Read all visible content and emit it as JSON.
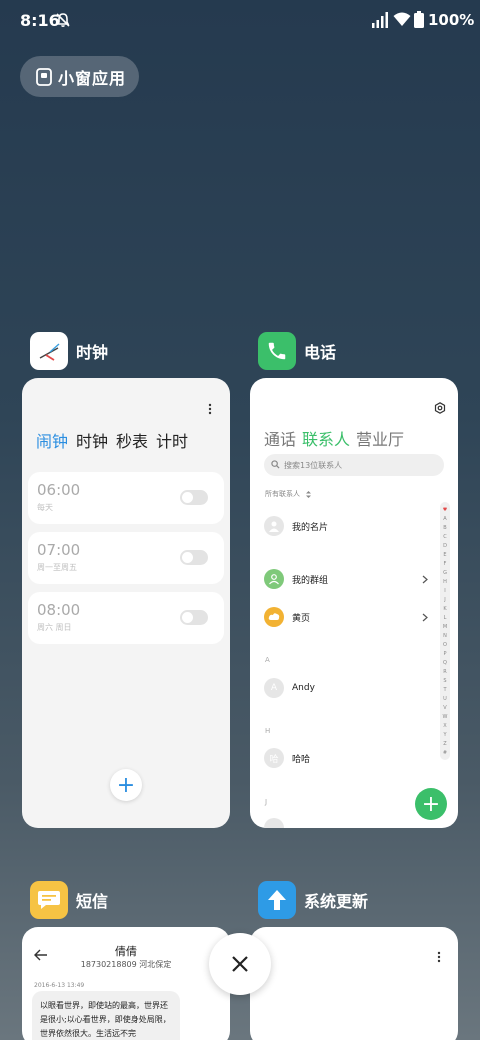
{
  "status_bar": {
    "time": "8:16",
    "battery": "100%"
  },
  "pill": {
    "label": "小窗应用"
  },
  "apps": {
    "clock": {
      "name": "时钟",
      "tabs": [
        "闹钟",
        "时钟",
        "秒表",
        "计时"
      ],
      "alarms": [
        {
          "time": "06:00",
          "repeat": "每天"
        },
        {
          "time": "07:00",
          "repeat": "周一至周五"
        },
        {
          "time": "08:00",
          "repeat": "周六 周日"
        }
      ],
      "add_symbol": "+"
    },
    "phone": {
      "name": "电话",
      "tabs": [
        "通话",
        "联系人",
        "营业厅"
      ],
      "search_placeholder": "搜索13位联系人",
      "all_contacts": "所有联系人",
      "my_card": "我的名片",
      "my_groups": "我的群组",
      "yellow_pages": "黄页",
      "section_a": "A",
      "contact_andy": "Andy",
      "avatar_a": "A",
      "section_h": "H",
      "contact_haha": "哈哈",
      "avatar_h": "哈",
      "section_j": "J",
      "index_letters": [
        "♥",
        "A",
        "B",
        "C",
        "D",
        "E",
        "F",
        "G",
        "H",
        "I",
        "J",
        "K",
        "L",
        "M",
        "N",
        "O",
        "P",
        "Q",
        "R",
        "S",
        "T",
        "U",
        "V",
        "W",
        "X",
        "Y",
        "Z",
        "#"
      ],
      "add_symbol": "+"
    },
    "messages": {
      "name": "短信",
      "contact_name": "倩倩",
      "contact_info": "18730218809 河北保定",
      "date": "2016-6-13 13:49",
      "message_text": "以眼看世界，即使站的最高，世界还是很小;以心看世界，即使身处局限，世界依然很大。生活远不完"
    },
    "system_update": {
      "name": "系统更新"
    }
  },
  "colors": {
    "clock_accent": "#2b8ee0",
    "phone_green": "#3bbf6a",
    "sms_yellow": "#f6c344",
    "update_blue": "#2e9be6"
  }
}
